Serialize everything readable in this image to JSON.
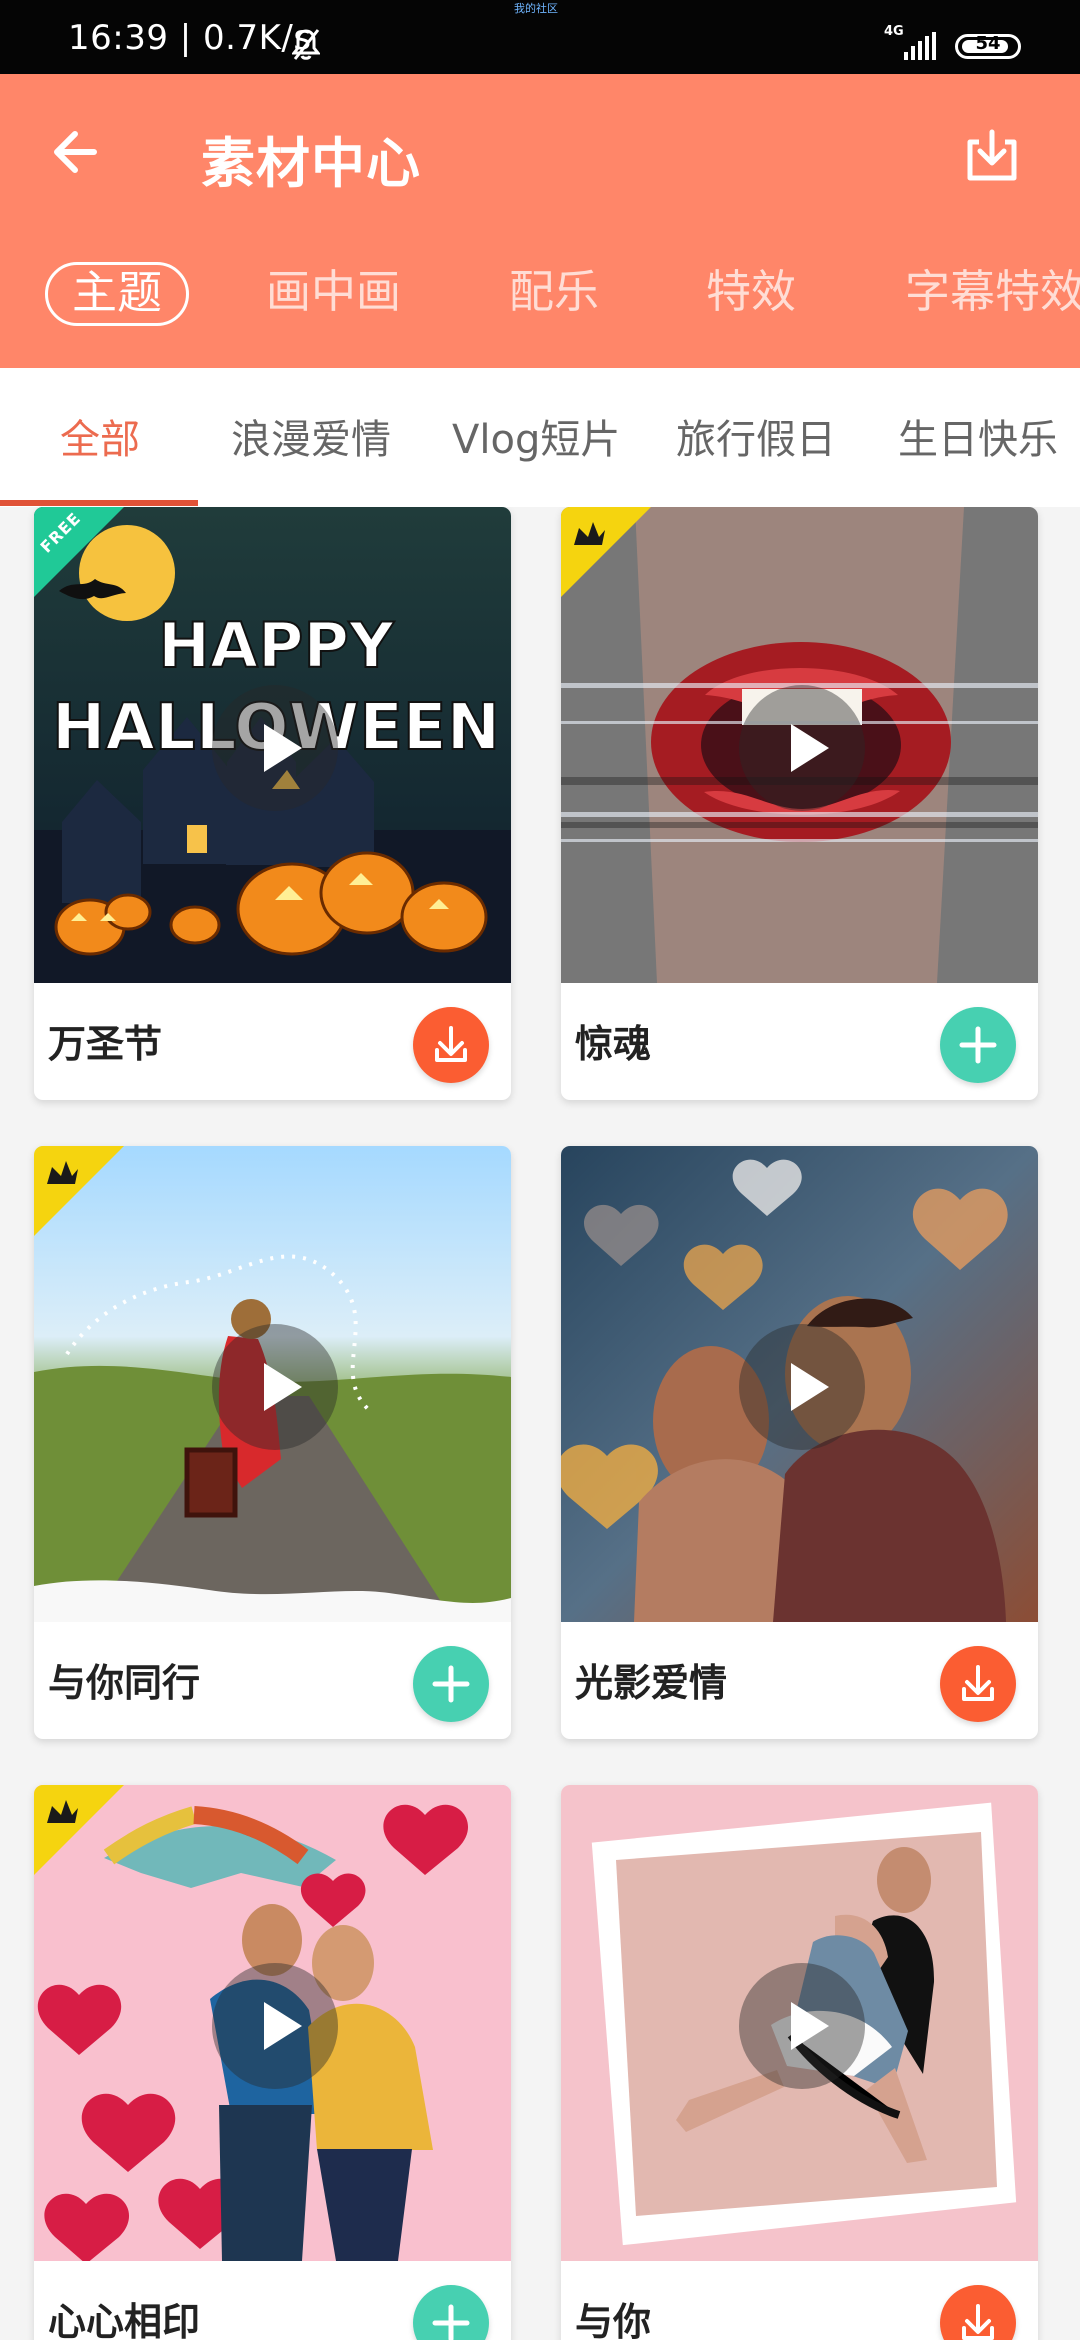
{
  "status": {
    "time_and_speed": "16:39 | 0.7K/s",
    "tiny_top_text": "我的社区",
    "network": "4G",
    "battery": "54"
  },
  "header": {
    "title": "素材中心",
    "category_tabs": [
      "主题",
      "画中画",
      "配乐",
      "特效",
      "字幕特效"
    ],
    "active_category": "主题"
  },
  "subtabs": {
    "items": [
      "全部",
      "浪漫爱情",
      "Vlog短片",
      "旅行假日",
      "生日快乐"
    ],
    "active": "全部"
  },
  "cards": [
    {
      "title": "万圣节",
      "badge": "FREE",
      "action": "download",
      "thumb_text": [
        "HAPPY",
        "HALLOWEEN"
      ]
    },
    {
      "title": "惊魂",
      "badge": "vip-crown-icon",
      "action": "add"
    },
    {
      "title": "与你同行",
      "badge": "vip-crown-icon",
      "action": "add"
    },
    {
      "title": "光影爱情",
      "badge": "",
      "action": "download"
    },
    {
      "title": "心心相印",
      "badge": "vip-crown-icon",
      "action": "add"
    },
    {
      "title": "与你",
      "badge": "",
      "action": "download"
    }
  ],
  "colors": {
    "header": "#ff8669",
    "active_subtab": "#ec6b4f",
    "download_button": "#fb5d32",
    "add_button": "#47d0b1"
  }
}
